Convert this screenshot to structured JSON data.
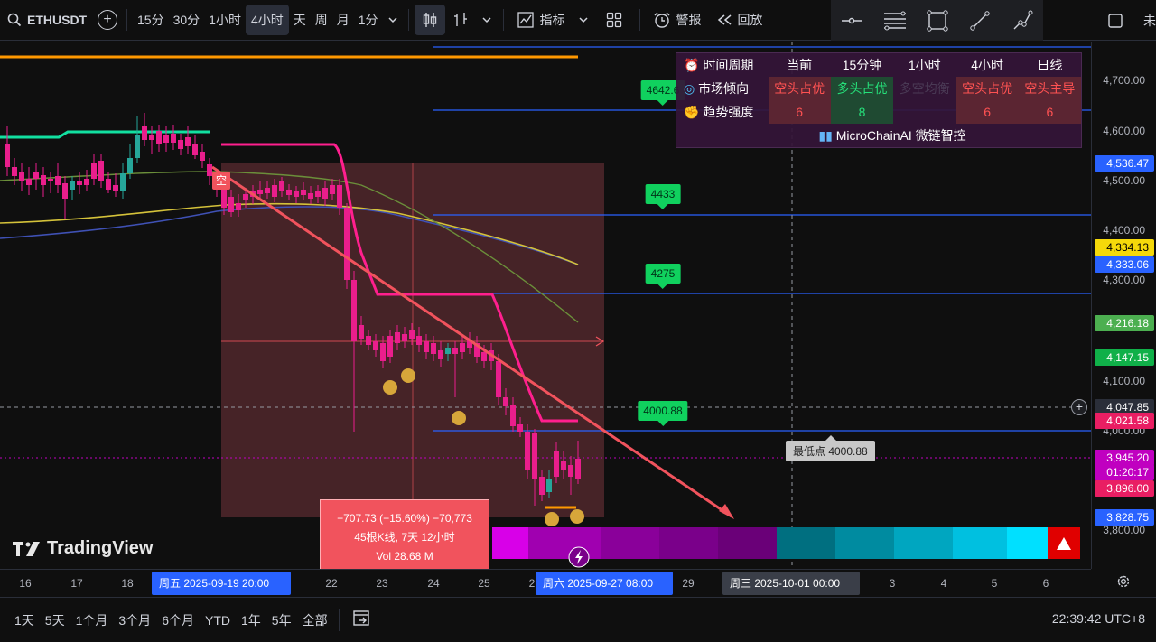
{
  "toolbar": {
    "symbol": "ETHUSDT",
    "intervals": [
      "15分",
      "30分",
      "1小时",
      "4小时",
      "天",
      "周",
      "月",
      "1分"
    ],
    "active_interval": "4小时",
    "indicators_label": "指标",
    "alert_label": "警报",
    "replay_label": "回放",
    "cut_label": "未"
  },
  "info_table": {
    "headers": [
      "时间周期",
      "当前",
      "15分钟",
      "1小时",
      "4小时",
      "日线"
    ],
    "row1_label": "市场倾向",
    "row1": [
      "空头占优",
      "多头占优",
      "多空均衡",
      "空头占优",
      "空头主导"
    ],
    "row2_label": "趋势强度",
    "row2": [
      "6",
      "8",
      "",
      "6",
      "6"
    ],
    "footer": "MicroChainAI 微链智控"
  },
  "flags": {
    "f1": "4642.6",
    "f2": "4433",
    "f3": "4275",
    "f4": "4000.88"
  },
  "short_signal": "空",
  "low_point": "最低点 4000.88",
  "measure": {
    "line1": "−707.73 (−15.60%) −70,773",
    "line2": "45根K线, 7天 12小时",
    "line3": "Vol 28.68 M"
  },
  "logo_text": "TradingView",
  "price_axis": {
    "labels": [
      "4,700.00",
      "4,600.00",
      "4,500.00",
      "4,400.00",
      "4,300.00",
      "4,100.00",
      "4,000.00",
      "3,800.00"
    ],
    "tags": [
      {
        "text": "4,536.47",
        "color": "#2962ff"
      },
      {
        "text": "4,334.13",
        "color": "#f5d90a"
      },
      {
        "text": "4,333.06",
        "color": "#2962ff"
      },
      {
        "text": "4,216.18",
        "color": "#4caf50"
      },
      {
        "text": "4,147.15",
        "color": "#10b049"
      },
      {
        "text": "4,047.85",
        "color": "#2a2e39"
      },
      {
        "text": "4,021.58",
        "color": "#e91e63"
      },
      {
        "text": "3,945.20",
        "color": "#c000c0"
      },
      {
        "text": "01:20:17",
        "color": "#c000c0"
      },
      {
        "text": "3,896.00",
        "color": "#e91e63"
      },
      {
        "text": "3,828.75",
        "color": "#2962ff"
      }
    ]
  },
  "time_axis": {
    "labels": [
      "16",
      "17",
      "18",
      "22",
      "23",
      "24",
      "25",
      "2",
      "29",
      "3",
      "4",
      "5",
      "6"
    ],
    "hl1": "周五 2025-09-19   20:00",
    "hl2": "周六 2025-09-27   08:00",
    "hl3": "周三 2025-10-01   00:00"
  },
  "bottom": {
    "ranges": [
      "1天",
      "5天",
      "1个月",
      "3个月",
      "6个月",
      "YTD",
      "1年",
      "5年",
      "全部"
    ],
    "clock": "22:39:42 UTC+8"
  },
  "colors": {
    "up": "#26a69a",
    "down": "#e91e8c",
    "supertrend_bull": "#12e0a0",
    "supertrend_bear": "#ff1f8e",
    "trendline": "#f1535d",
    "hline": "#2962ff"
  }
}
